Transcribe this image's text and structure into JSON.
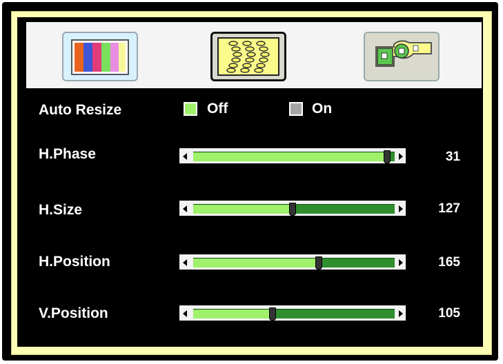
{
  "tabs": [
    {
      "icon": "color-bars-icon"
    },
    {
      "icon": "waves-icon"
    },
    {
      "icon": "tools-icon"
    }
  ],
  "auto_resize": {
    "label": "Auto Resize",
    "options": [
      {
        "label": "Off",
        "color": "#9ff06a"
      },
      {
        "label": "On",
        "color": "#a6a6a6"
      }
    ],
    "selected": "Off"
  },
  "settings": [
    {
      "label": "H.Phase",
      "value": "31",
      "fraction": 0.96
    },
    {
      "label": "H.Size",
      "value": "127",
      "fraction": 0.49
    },
    {
      "label": "H.Position",
      "value": "165",
      "fraction": 0.62
    },
    {
      "label": "V.Position",
      "value": "105",
      "fraction": 0.39
    }
  ],
  "colors": {
    "fill": "#9ff06a",
    "track": "#2f8f2f",
    "frame": "#fdfdb4"
  }
}
